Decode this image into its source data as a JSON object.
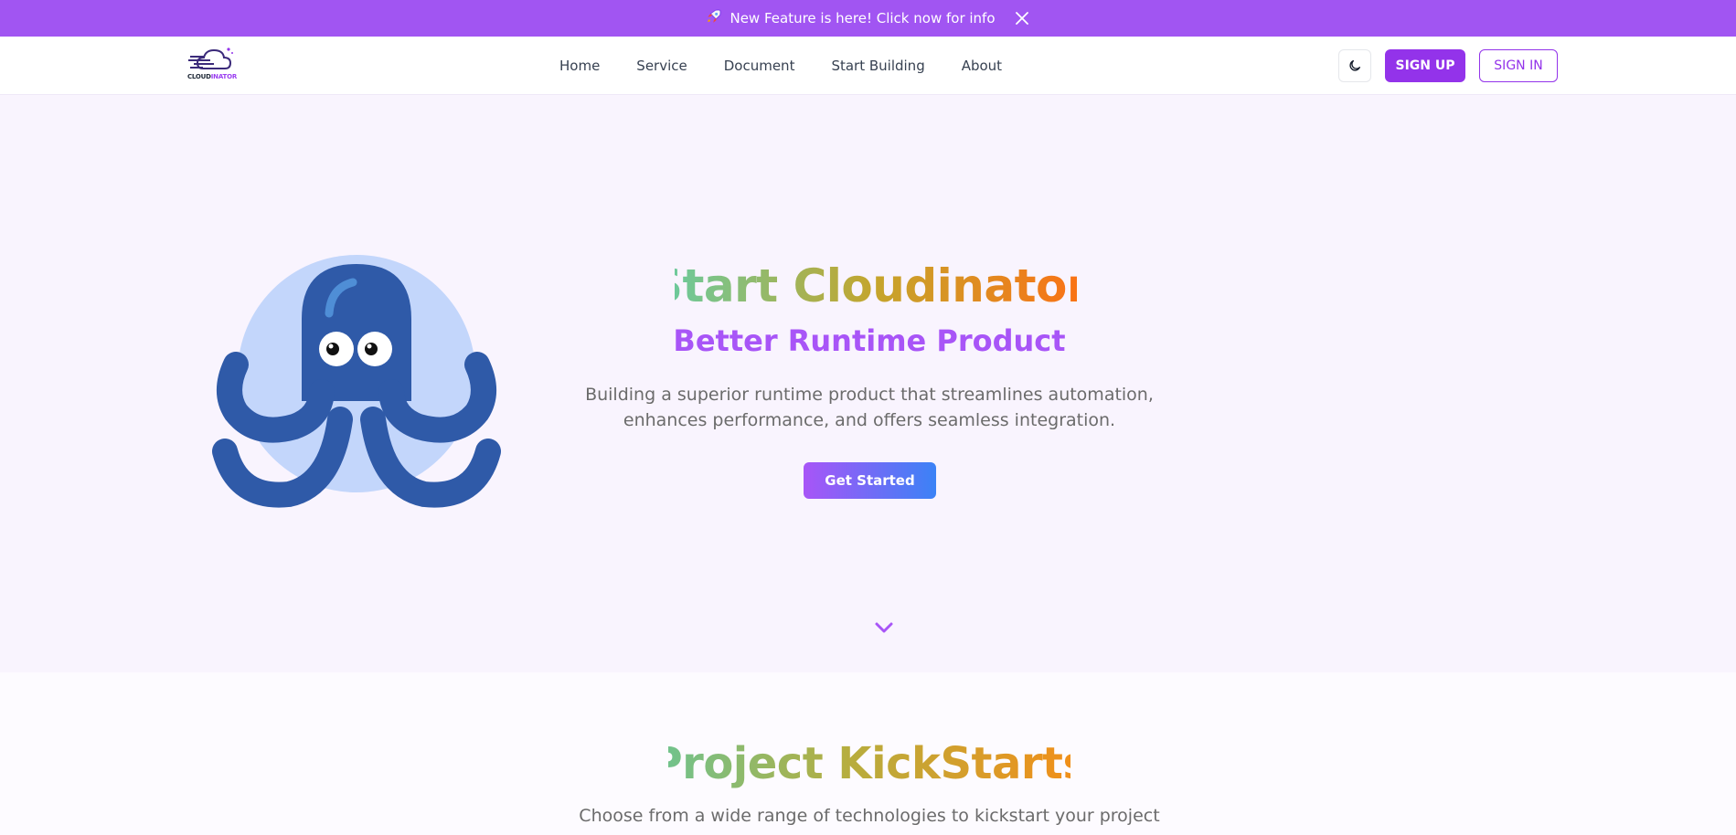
{
  "announcement": {
    "icon": "rocket-icon",
    "text": "New Feature is here! Click now for info",
    "close_icon": "close-icon"
  },
  "header": {
    "logo_text_main": "CLOUD",
    "logo_text_accent": "INATOR",
    "nav": [
      "Home",
      "Service",
      "Document",
      "Start Building",
      "About"
    ],
    "theme_toggle_icon": "moon-icon",
    "signup_label": "SIGN UP",
    "signin_label": "SIGN IN"
  },
  "hero": {
    "title": "Start Cloudinator",
    "subtitle": "Better Runtime Product",
    "description": "Building a superior runtime product that streamlines automation, enhances performance, and offers seamless integration.",
    "cta_label": "Get Started",
    "mascot": "octopus-illustration",
    "scroll_icon": "chevron-down-icon"
  },
  "projects": {
    "title": "Project KickStarts",
    "description": "Choose from a wide range of technologies to kickstart your project"
  },
  "colors": {
    "accent": "#9333ea",
    "announcement_bg": "#a155f2",
    "hero_bg": "#f9f4fe",
    "octopus": "#2f5aa8",
    "octopus_bg": "#c3d6fb"
  }
}
